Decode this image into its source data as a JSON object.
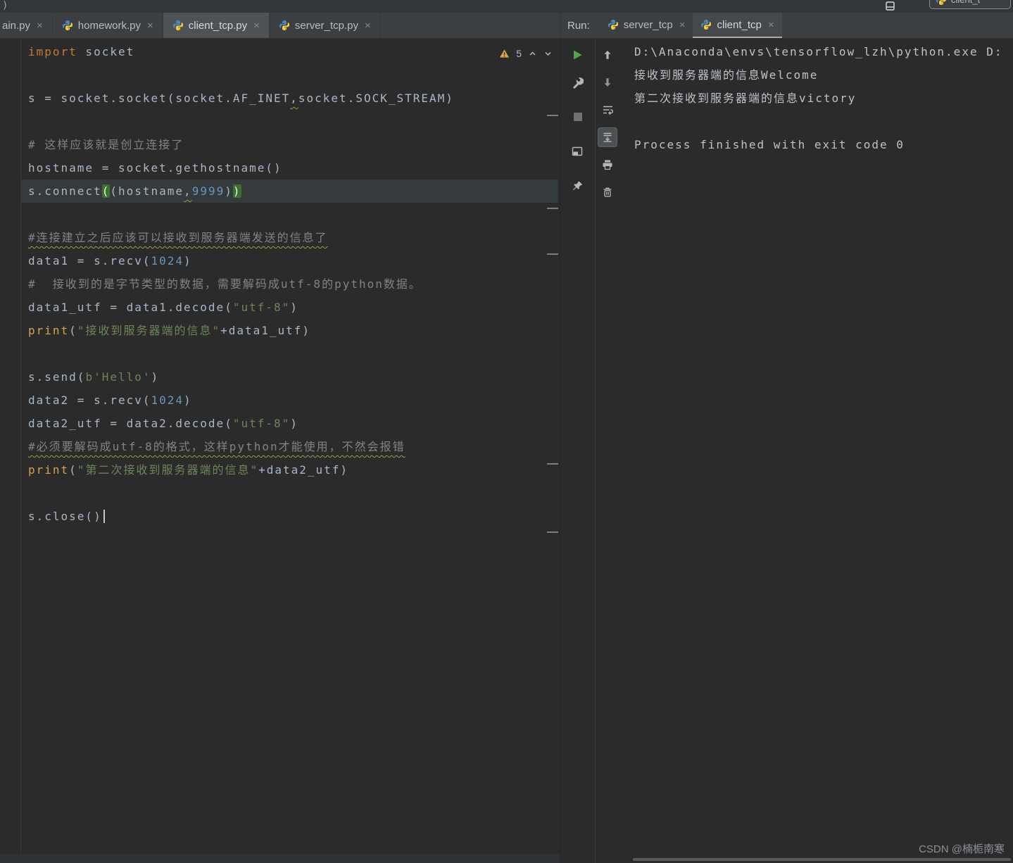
{
  "window": {
    "title_fragment": ")",
    "runconfig_partial": "client_t"
  },
  "glyphs": {
    "close": "×"
  },
  "editor_tabs": [
    {
      "label": "ain.py",
      "active": false
    },
    {
      "label": "homework.py",
      "active": false
    },
    {
      "label": "client_tcp.py",
      "active": true
    },
    {
      "label": "server_tcp.py",
      "active": false
    }
  ],
  "run_panel": {
    "label": "Run:",
    "tabs": [
      {
        "label": "server_tcp",
        "active": false
      },
      {
        "label": "client_tcp",
        "active": true
      }
    ]
  },
  "inspection": {
    "warning_count": "5"
  },
  "editor": {
    "lines": [
      {
        "seg": [
          [
            "k",
            "import"
          ],
          [
            "p",
            " socket"
          ]
        ]
      },
      {
        "seg": []
      },
      {
        "seg": [
          [
            "p",
            "s = socket.socket(socket.AF_INET"
          ],
          [
            "w",
            ","
          ],
          [
            "p",
            "socket.SOCK_STREAM)"
          ]
        ]
      },
      {
        "seg": []
      },
      {
        "seg": [
          [
            "c",
            "# 这样应该就是创立连接了"
          ]
        ]
      },
      {
        "seg": [
          [
            "p",
            "hostname = socket.gethostname()"
          ]
        ]
      },
      {
        "hl": true,
        "seg": [
          [
            "p",
            "s.connect"
          ],
          [
            "m",
            "("
          ],
          [
            "p",
            "(hostname"
          ],
          [
            "w",
            ","
          ],
          [
            "n",
            "9999"
          ],
          [
            "p",
            ")"
          ],
          [
            "m",
            ")"
          ]
        ]
      },
      {
        "seg": []
      },
      {
        "seg": [
          [
            "u",
            "#连接建立之后应该可以接收到服务器端发送的信息了"
          ]
        ]
      },
      {
        "seg": [
          [
            "p",
            "data1 = s.recv("
          ],
          [
            "n",
            "1024"
          ],
          [
            "p",
            ")"
          ]
        ]
      },
      {
        "seg": [
          [
            "c",
            "#  接收到的是字节类型的数据，需要解码成utf-8的python数据。"
          ]
        ]
      },
      {
        "seg": [
          [
            "p",
            "data1_utf = data1.decode("
          ],
          [
            "s",
            "\"utf-8\""
          ],
          [
            "p",
            ")"
          ]
        ]
      },
      {
        "seg": [
          [
            "b",
            "print"
          ],
          [
            "p",
            "("
          ],
          [
            "s",
            "\"接收到服务器端的信息\""
          ],
          [
            "p",
            "+data1_utf)"
          ]
        ]
      },
      {
        "seg": []
      },
      {
        "seg": [
          [
            "p",
            "s.send("
          ],
          [
            "s",
            "b'Hello'"
          ],
          [
            "p",
            ")"
          ]
        ]
      },
      {
        "seg": [
          [
            "p",
            "data2 = s.recv("
          ],
          [
            "n",
            "1024"
          ],
          [
            "p",
            ")"
          ]
        ]
      },
      {
        "seg": [
          [
            "p",
            "data2_utf = data2.decode("
          ],
          [
            "s",
            "\"utf-8\""
          ],
          [
            "p",
            ")"
          ]
        ]
      },
      {
        "seg": [
          [
            "u",
            "#必须要解码成utf-8的格式，这样python才能使用，不然会报错"
          ]
        ]
      },
      {
        "seg": [
          [
            "b",
            "print"
          ],
          [
            "p",
            "("
          ],
          [
            "s",
            "\"第二次接收到服务器端的信息\""
          ],
          [
            "p",
            "+data2_utf)"
          ]
        ]
      },
      {
        "seg": []
      },
      {
        "caret": true,
        "seg": [
          [
            "p",
            "s.close()"
          ]
        ]
      }
    ]
  },
  "console": {
    "lines": [
      "D:\\Anaconda\\envs\\tensorflow_lzh\\python.exe D:",
      "接收到服务器端的信息Welcome",
      "第二次接收到服务器端的信息victory",
      "",
      "Process finished with exit code 0"
    ]
  },
  "toolbars": {
    "run": [
      "rerun-icon",
      "edit-configurations-icon",
      "stop-icon",
      "restore-layout-icon",
      "pin-icon"
    ],
    "console": [
      "prev-occurrence-icon",
      "next-occurrence-icon",
      "soft-wrap-icon",
      "scroll-to-end-icon",
      "print-icon",
      "clear-all-icon"
    ]
  },
  "watermark": "CSDN @楠栀南寒",
  "colors": {
    "background": "#2b2b2b",
    "tab_bar": "#3c3f41",
    "active_tab": "#4e5254",
    "keyword": "#cc7832",
    "string": "#6a8759",
    "number": "#6897bb",
    "comment": "#7f8487",
    "builtin": "#d8a24a",
    "plain_code": "#a9b7c6",
    "run_green": "#4fa747",
    "matched_brace_bg": "#3c7030",
    "line_highlight": "#353a3d"
  }
}
